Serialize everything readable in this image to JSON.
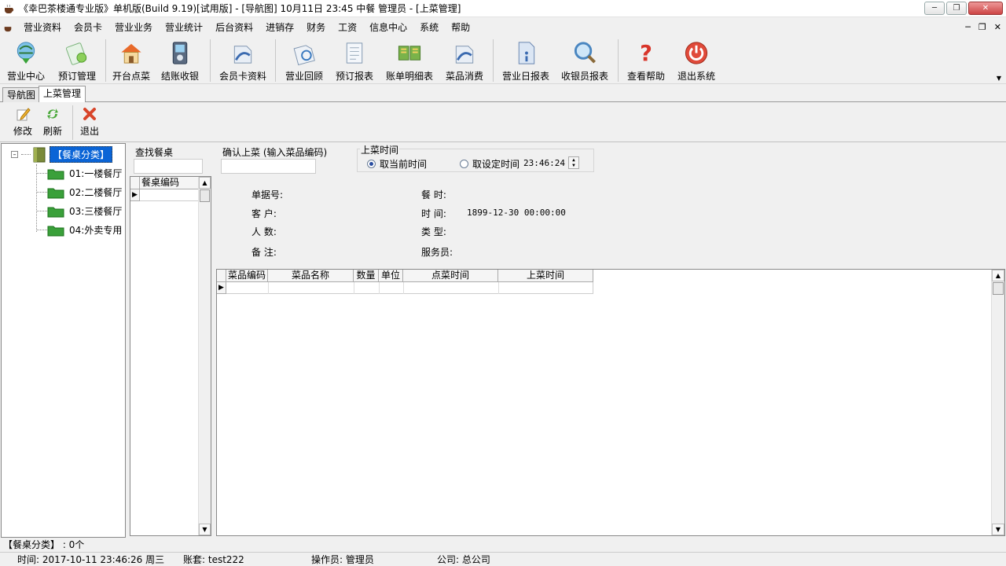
{
  "window": {
    "title": "《幸巴茶楼通专业版》单机版(Build 9.19)[试用版] - [导航图]  10月11日 23:45 中餐 管理员 - [上菜管理]"
  },
  "menu": [
    "营业资料",
    "会员卡",
    "营业业务",
    "营业统计",
    "后台资料",
    "进销存",
    "财务",
    "工资",
    "信息中心",
    "系统",
    "帮助"
  ],
  "toolbar": [
    {
      "label": "营业中心",
      "icon": "business-center-icon"
    },
    {
      "label": "预订管理",
      "icon": "reservation-icon"
    },
    {
      "label": "开台点菜",
      "icon": "open-table-icon"
    },
    {
      "label": "结账收银",
      "icon": "checkout-icon"
    },
    {
      "label": "会员卡资料",
      "icon": "member-card-icon"
    },
    {
      "label": "营业回顾",
      "icon": "review-icon"
    },
    {
      "label": "预订报表",
      "icon": "reservation-report-icon"
    },
    {
      "label": "账单明细表",
      "icon": "bill-detail-icon"
    },
    {
      "label": "菜品消费",
      "icon": "dish-consumption-icon"
    },
    {
      "label": "营业日报表",
      "icon": "daily-report-icon"
    },
    {
      "label": "收银员报表",
      "icon": "cashier-report-icon"
    },
    {
      "label": "查看帮助",
      "icon": "help-icon"
    },
    {
      "label": "退出系统",
      "icon": "power-icon"
    }
  ],
  "tabs": [
    "导航图",
    "上菜管理"
  ],
  "subbar": [
    {
      "label": "修改",
      "icon": "edit-icon"
    },
    {
      "label": "刷新",
      "icon": "refresh-icon"
    },
    {
      "label": "退出",
      "icon": "exit-icon"
    }
  ],
  "tree": {
    "root": "【餐桌分类】",
    "nodes": [
      "01:一楼餐厅",
      "02:二楼餐厅",
      "03:三楼餐厅",
      "04:外卖专用"
    ]
  },
  "find_table": {
    "label": "查找餐桌",
    "column": "餐桌编码"
  },
  "serve": {
    "confirm_label": "确认上菜 (输入菜品编码)",
    "time_group_label": "上菜时间",
    "radio_current": "取当前时间",
    "radio_custom": "取设定时间",
    "time_value": "23:46:24"
  },
  "order_info": {
    "bill_no_label": "单据号:",
    "customer_label": "客  户:",
    "people_label": "人  数:",
    "note_label": "备  注:",
    "meal_label": "餐  时:",
    "time_label": "时  间:",
    "time_value": "1899-12-30 00:00:00",
    "type_label": "类  型:",
    "waiter_label": "服务员:"
  },
  "dish_grid": {
    "columns": [
      "菜品编码",
      "菜品名称",
      "数量",
      "单位",
      "点菜时间",
      "上菜时间"
    ]
  },
  "status": {
    "line1": "【餐桌分类】 : 0个",
    "time": "时间: 2017-10-11 23:46:26 周三",
    "account": "账套: test222",
    "operator": "操作员: 管理员",
    "company": "公司: 总公司"
  }
}
